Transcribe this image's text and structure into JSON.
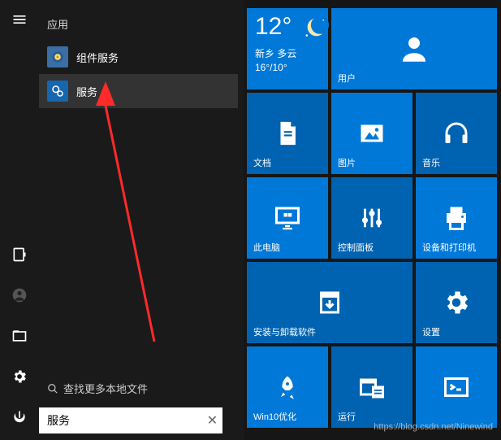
{
  "apps": {
    "header": "应用",
    "items": [
      {
        "label": "组件服务"
      },
      {
        "label": "服务"
      }
    ]
  },
  "search": {
    "more_label": "查找更多本地文件",
    "value": "服务"
  },
  "weather": {
    "temp": "12°",
    "location": "新乡 多云",
    "range": "16°/10°"
  },
  "tiles": [
    {
      "key": "user",
      "label": "用户"
    },
    {
      "key": "docs",
      "label": "文档"
    },
    {
      "key": "pictures",
      "label": "图片"
    },
    {
      "key": "music",
      "label": "音乐"
    },
    {
      "key": "thispc",
      "label": "此电脑"
    },
    {
      "key": "control",
      "label": "控制面板"
    },
    {
      "key": "printers",
      "label": "设备和打印机"
    },
    {
      "key": "install",
      "label": "安装与卸载软件"
    },
    {
      "key": "settings",
      "label": "设置"
    },
    {
      "key": "win10opt",
      "label": "Win10优化"
    },
    {
      "key": "run",
      "label": "运行"
    },
    {
      "key": "cmd",
      "label": ""
    }
  ],
  "watermark": "https://blog.csdn.net/Ninewind"
}
